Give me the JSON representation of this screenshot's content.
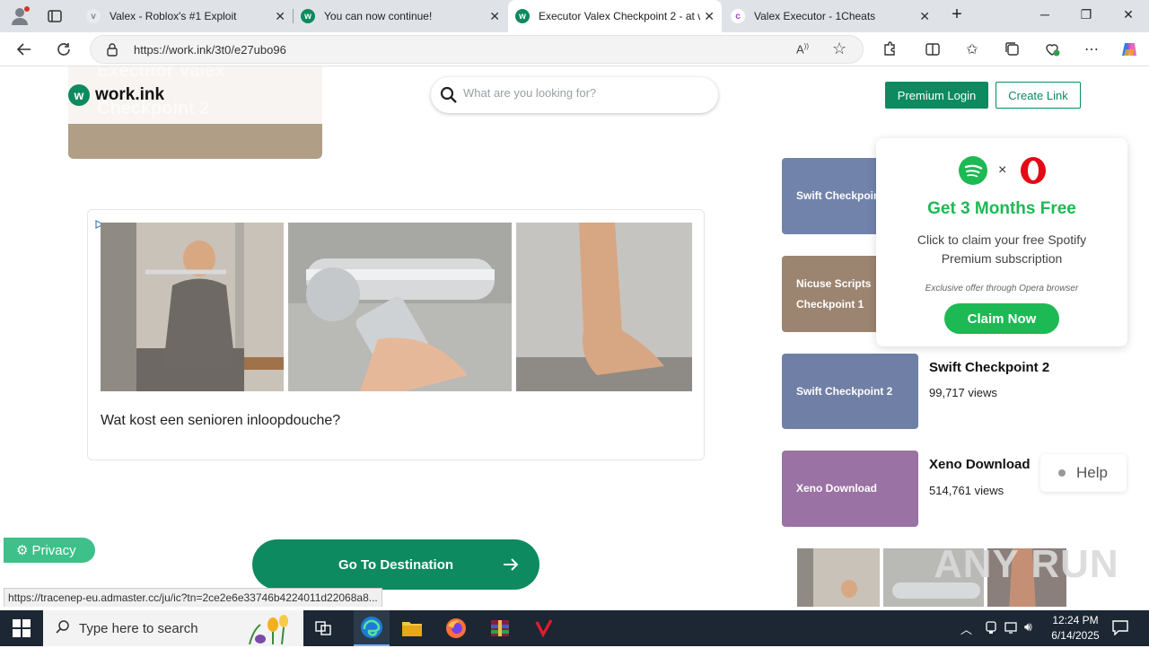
{
  "browser": {
    "tabs": [
      {
        "title": "Valex - Roblox's #1 Exploit",
        "icon": "valex-tab-icon"
      },
      {
        "title": "You can now continue!",
        "icon": "workink-tab-icon"
      },
      {
        "title": "Executor Valex Checkpoint 2 - at w",
        "icon": "workink-tab-icon",
        "active": true
      },
      {
        "title": "Valex Executor - 1Cheats",
        "icon": "1cheats-tab-icon"
      }
    ],
    "url": "https://work.ink/3t0/e27ubo96"
  },
  "site": {
    "logo_text": "work.ink",
    "logo_letter": "w",
    "hero_ghost_line1": "Executor Valex",
    "hero_ghost_line2": "Checkpoint 2",
    "search_placeholder": "What are you looking for?",
    "premium_login": "Premium Login",
    "create_link": "Create Link",
    "go_button": "Go To Destination",
    "privacy": "Privacy",
    "help": "Help"
  },
  "ad": {
    "caption": "Wat kost een senioren inloopdouche?"
  },
  "related": [
    {
      "tile": "Swift Checkpoint",
      "title": "",
      "views": "",
      "color": "#7183aa"
    },
    {
      "tile": "Nicuse Scripts Checkpoint 1",
      "title": "",
      "views": "",
      "color": "#9b8470"
    },
    {
      "tile": "Swift Checkpoint 2",
      "title": "Swift Checkpoint 2",
      "views": "99,717 views",
      "color": "#6f7fa6"
    },
    {
      "tile": "Xeno Download",
      "title": "Xeno Download",
      "views": "514,761 views",
      "color": "#9a72a4"
    }
  ],
  "popup": {
    "times": "×",
    "headline": "Get 3 Months Free",
    "body": "Click to claim your free Spotify Premium subscription",
    "note": "Exclusive offer through Opera browser",
    "cta": "Claim Now"
  },
  "status_url": "https://tracenep-eu.admaster.cc/ju/ic?tn=2ce2e6e33746b4224011d22068a8...",
  "watermark": "ANY RUN",
  "taskbar": {
    "search_placeholder": "Type here to search",
    "time": "12:24 PM",
    "date": "6/14/2025"
  },
  "colors": {
    "brand_green": "#0d8a5f",
    "spotify_green": "#1db954",
    "opera_red": "#e50914"
  }
}
